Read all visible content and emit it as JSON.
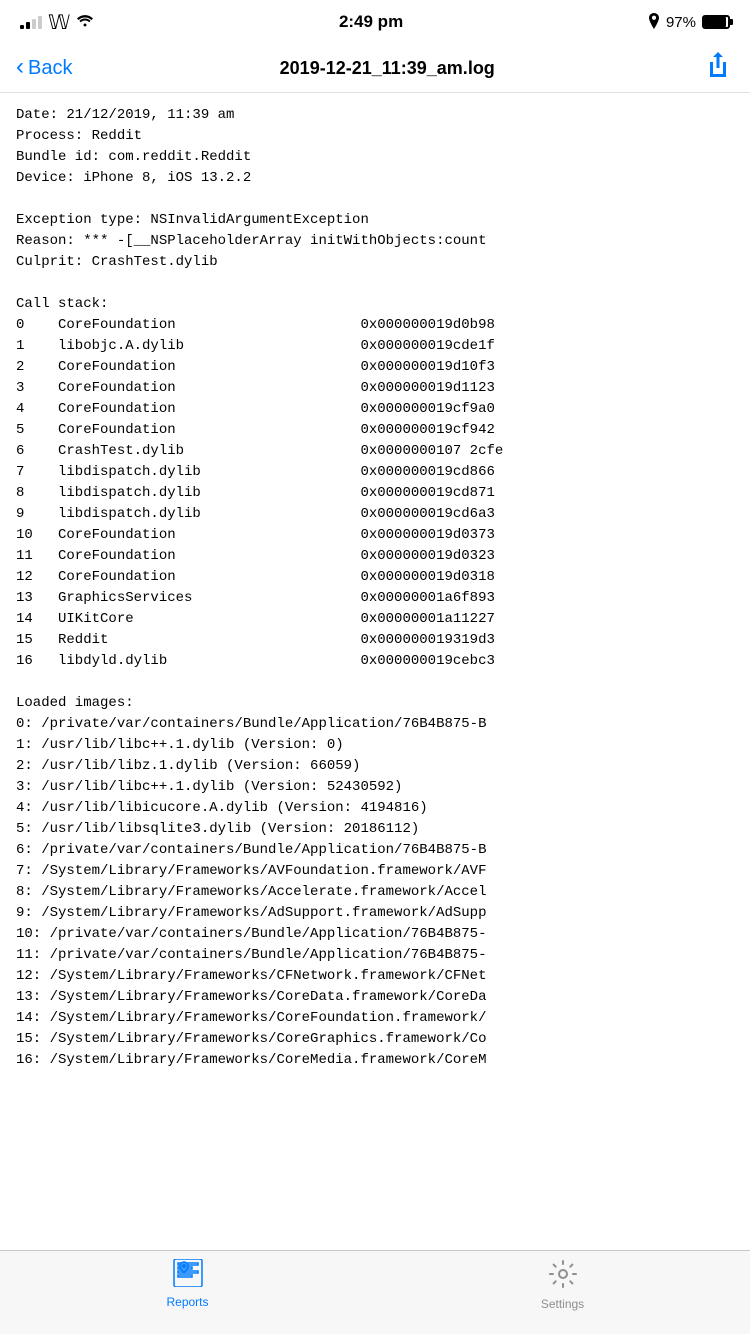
{
  "statusBar": {
    "time": "2:49 pm",
    "batteryPercent": "97%"
  },
  "header": {
    "backLabel": "Back",
    "title": "2019-12-21_11:39_am.log"
  },
  "logContent": "Date: 21/12/2019, 11:39 am\nProcess: Reddit\nBundle id: com.reddit.Reddit\nDevice: iPhone 8, iOS 13.2.2\n\nException type: NSInvalidArgumentException\nReason: *** -[__NSPlaceholderArray initWithObjects:count\nCulprit: CrashTest.dylib\n\nCall stack:\n0    CoreFoundation                      0x000000019d0b98\n1    libobjc.A.dylib                     0x000000019cde1f\n2    CoreFoundation                      0x000000019d10f3\n3    CoreFoundation                      0x000000019d1123\n4    CoreFoundation                      0x000000019cf9a0\n5    CoreFoundation                      0x000000019cf942\n6    CrashTest.dylib                     0x0000000107 2cfe\n7    libdispatch.dylib                   0x000000019cd866\n8    libdispatch.dylib                   0x000000019cd871\n9    libdispatch.dylib                   0x000000019cd6a3\n10   CoreFoundation                      0x000000019d0373\n11   CoreFoundation                      0x000000019d0323\n12   CoreFoundation                      0x000000019d0318\n13   GraphicsServices                    0x00000001a6f893\n14   UIKitCore                           0x00000001a11227\n15   Reddit                              0x000000019319d3\n16   libdyld.dylib                       0x000000019cebc3\n\nLoaded images:\n0: /private/var/containers/Bundle/Application/76B4B875-B\n1: /usr/lib/libc++.1.dylib (Version: 0)\n2: /usr/lib/libz.1.dylib (Version: 66059)\n3: /usr/lib/libc++.1.dylib (Version: 52430592)\n4: /usr/lib/libicucore.A.dylib (Version: 4194816)\n5: /usr/lib/libsqlite3.dylib (Version: 20186112)\n6: /private/var/containers/Bundle/Application/76B4B875-B\n7: /System/Library/Frameworks/AVFoundation.framework/AVF\n8: /System/Library/Frameworks/Accelerate.framework/Accel\n9: /System/Library/Frameworks/AdSupport.framework/AdSupp\n10: /private/var/containers/Bundle/Application/76B4B875-\n11: /private/var/containers/Bundle/Application/76B4B875-\n12: /System/Library/Frameworks/CFNetwork.framework/CFNet\n13: /System/Library/Frameworks/CoreData.framework/CoreDa\n14: /System/Library/Frameworks/CoreFoundation.framework/\n15: /System/Library/Frameworks/CoreGraphics.framework/Co\n16: /System/Library/Frameworks/CoreMedia.framework/CoreM",
  "tabBar": {
    "items": [
      {
        "id": "reports",
        "label": "Reports",
        "active": true
      },
      {
        "id": "settings",
        "label": "Settings",
        "active": false
      }
    ]
  }
}
